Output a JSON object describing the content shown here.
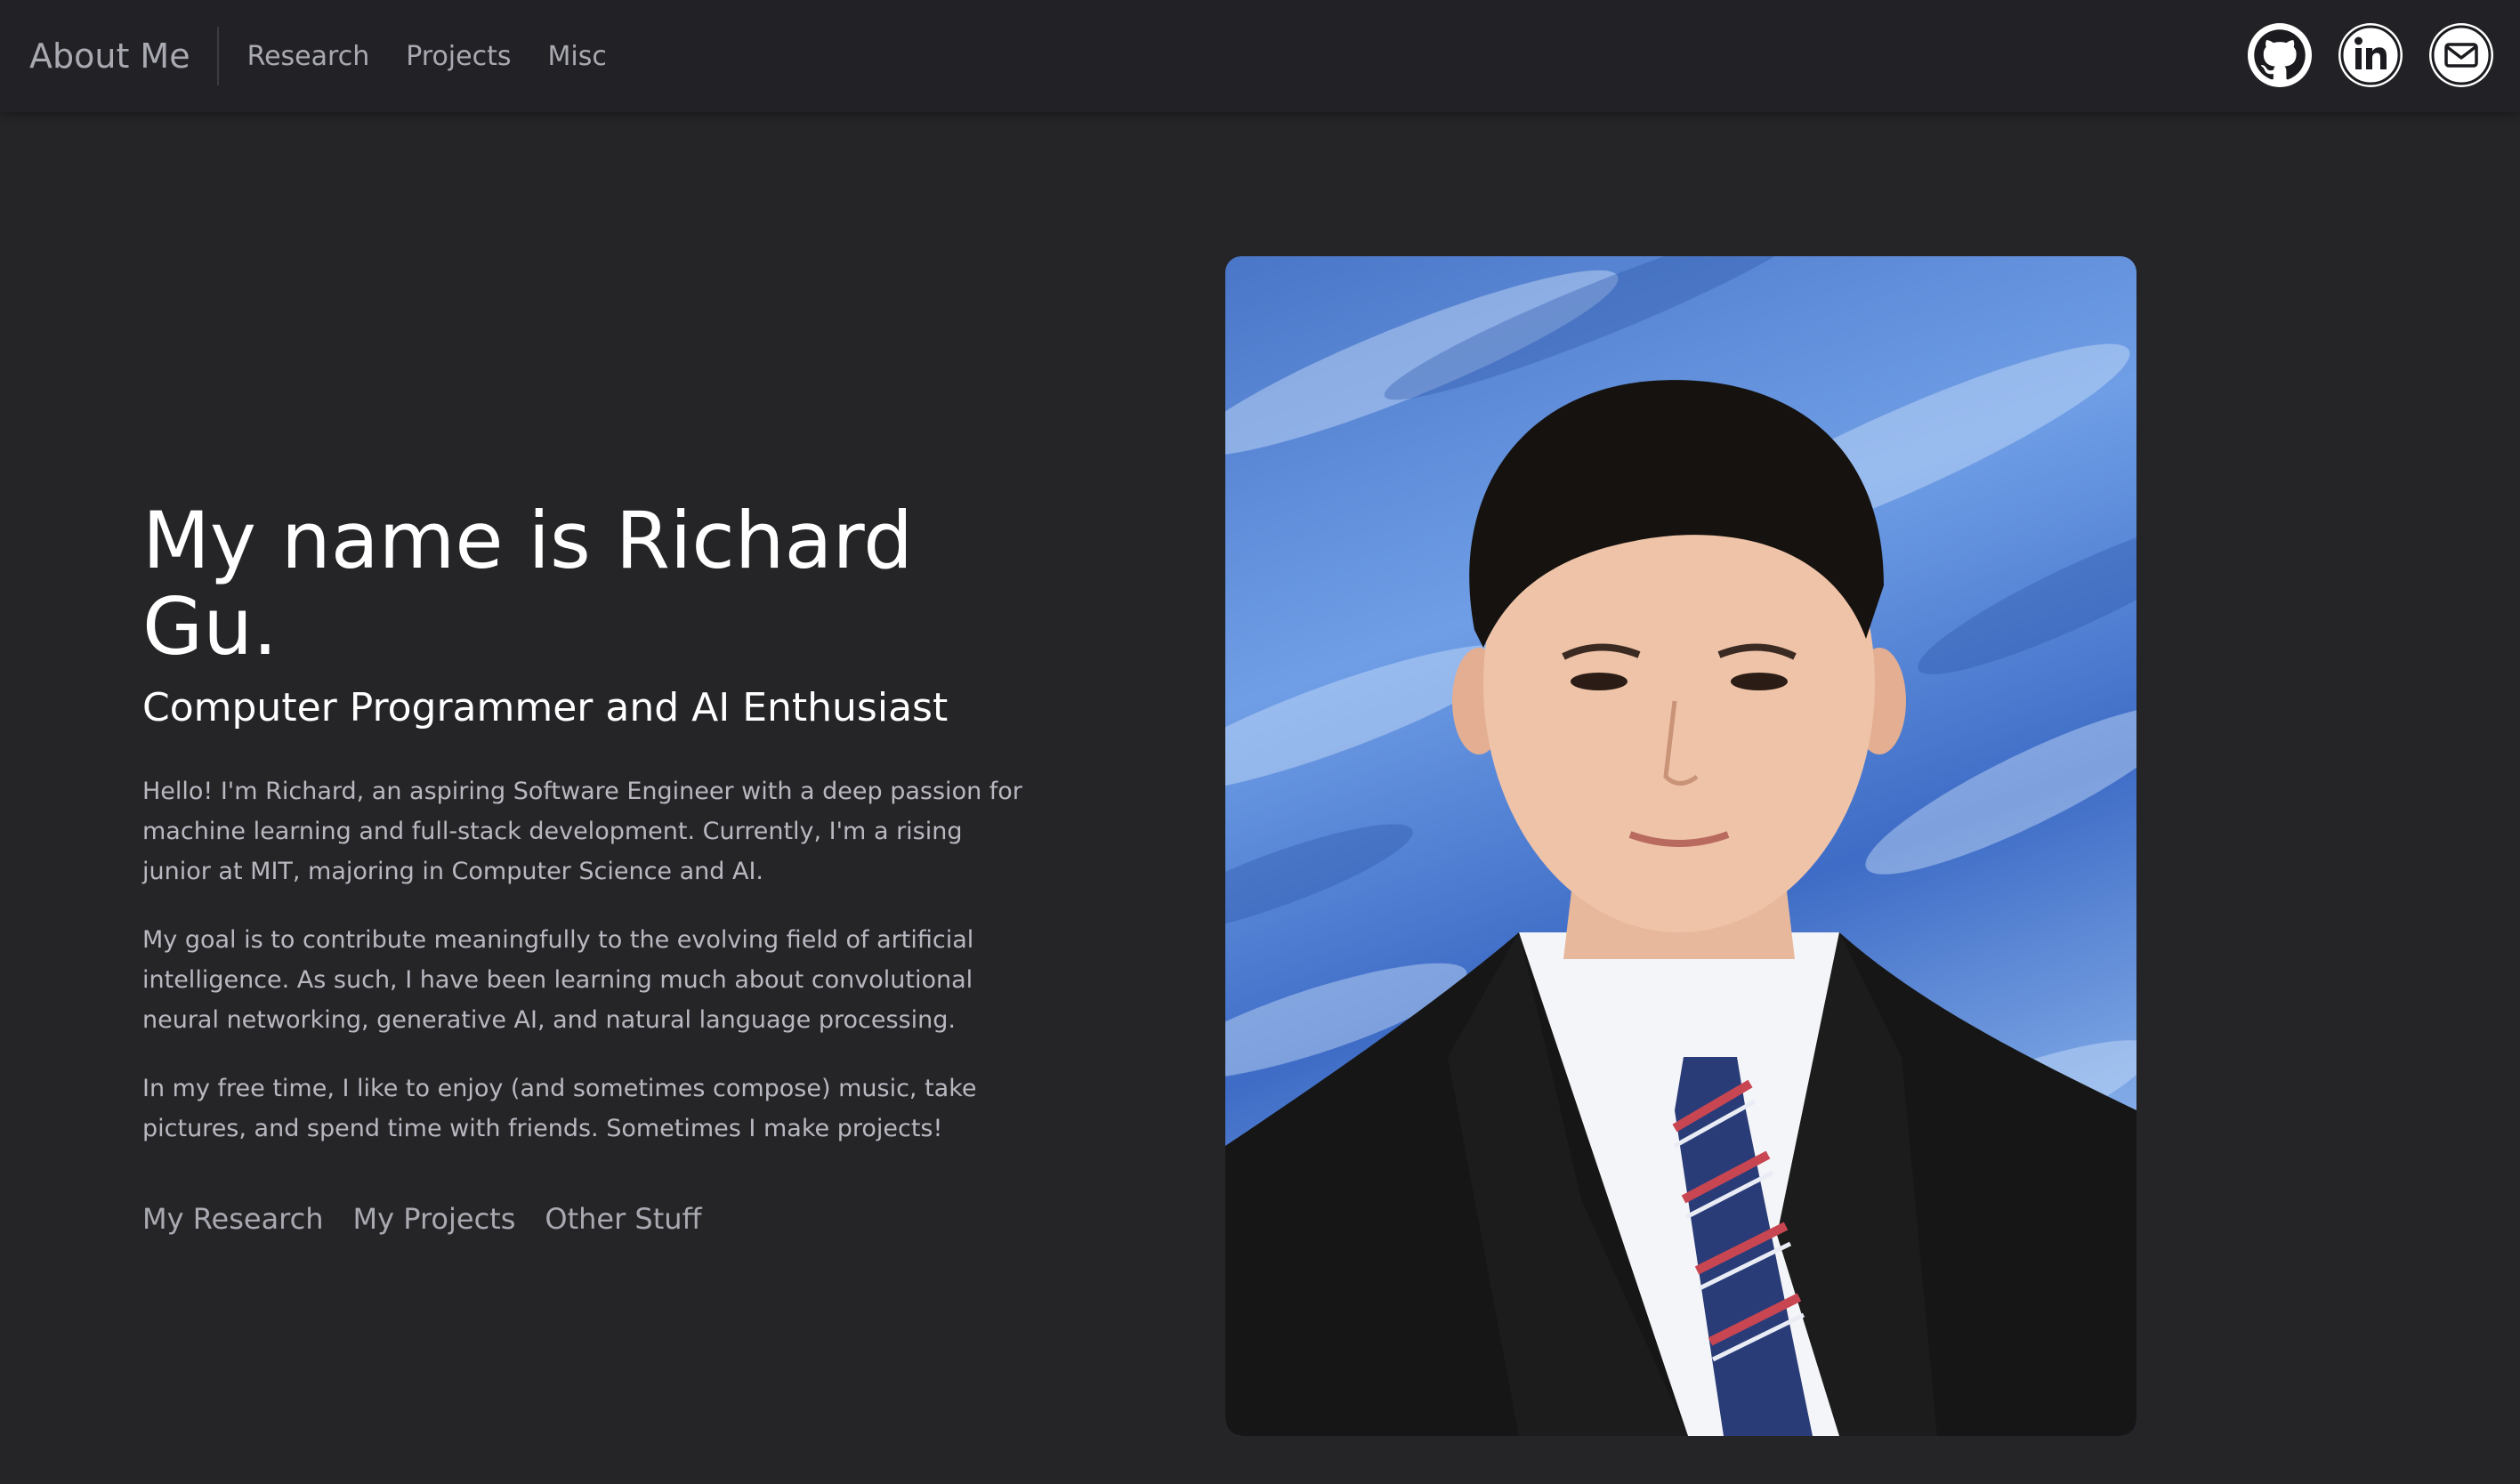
{
  "navbar": {
    "brand": "About Me",
    "links": [
      "Research",
      "Projects",
      "Misc"
    ],
    "socials": [
      "github-icon",
      "linkedin-icon",
      "mail-icon"
    ]
  },
  "hero": {
    "title": "My name is Richard Gu.",
    "subtitle": "Computer Programmer and AI Enthusiast",
    "paragraphs": [
      "Hello! I'm Richard, an aspiring Software Engineer with a deep passion for machine learning and full-stack development. Currently, I'm a rising junior at MIT, majoring in Computer Science and AI.",
      "My goal is to contribute meaningfully to the evolving field of artificial intelligence. As such, I have been learning much about convolutional neural networking, generative AI, and natural language processing.",
      "In my free time, I like to enjoy (and sometimes compose) music, take pictures, and spend time with friends. Sometimes I make projects!"
    ],
    "links": [
      "My Research",
      "My Projects",
      "Other Stuff"
    ]
  },
  "colors": {
    "background": "#252528",
    "navbar": "#222226",
    "muted_text": "#a9aab1",
    "body_text": "#b8b8c0",
    "portrait_sky": "#4a76c8"
  }
}
